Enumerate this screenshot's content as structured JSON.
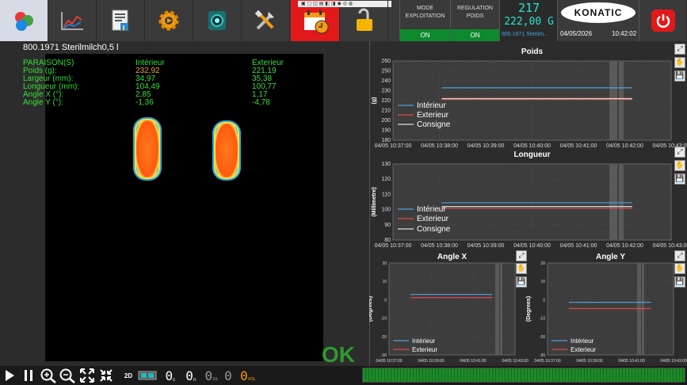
{
  "toolbar": {
    "buttons": [
      {
        "name": "home",
        "icon": "colored-dots-logo-icon"
      },
      {
        "name": "trends",
        "icon": "line-chart-icon"
      },
      {
        "name": "report",
        "icon": "report-document-icon"
      },
      {
        "name": "settings",
        "icon": "gear-icon"
      },
      {
        "name": "camera",
        "icon": "camera-icon"
      },
      {
        "name": "tools",
        "icon": "tools-icon"
      },
      {
        "name": "calendar-alarm",
        "icon": "calendar-alarm-icon"
      },
      {
        "name": "lock",
        "icon": "padlock-open-icon"
      }
    ],
    "mode_exploitation": {
      "label": "MODE\nEXPLOITATION",
      "state": "ON"
    },
    "regulation_poids": {
      "label": "REGULATION\nPOIDS",
      "state": "ON"
    },
    "counter": "217",
    "weight_display": "222,00 G",
    "product_ref": "800.1971 Sterilm...",
    "brand": "KONATIC",
    "date": "04/05/2026",
    "time": "10:42:02",
    "colors": {
      "active_bg": "#d7dbe6",
      "alarm_red": "#e2191b",
      "on_green": "#0e8a2e",
      "segment_cyan": "#2de3d0"
    }
  },
  "left": {
    "product_title": "800.1971 Sterilmilch0,5 l",
    "header_label": "PARAISON(S)",
    "col_interior": "Intérieur",
    "col_exterior": "Exterieur",
    "rows": [
      {
        "label": "Poids (g):",
        "interior": "232,92",
        "exterior": "221,19"
      },
      {
        "label": "Largeur (mm):",
        "interior": "34,97",
        "exterior": "35,38"
      },
      {
        "label": "Longueur (mm):",
        "interior": "104,49",
        "exterior": "100,77"
      },
      {
        "label": "Angle X (°):",
        "interior": "2,85",
        "exterior": "1,17"
      },
      {
        "label": "Angle Y (°):",
        "interior": "-1,36",
        "exterior": "-4,78"
      }
    ],
    "status": "OK"
  },
  "chart_data": [
    {
      "type": "line",
      "title": "Poids",
      "ylabel": "(g)",
      "ylim": [
        180,
        260
      ],
      "yticks": [
        "260",
        "250",
        "240",
        "230",
        "220",
        "210",
        "200",
        "190",
        "180"
      ],
      "xticks": [
        "04/05 10:37:00",
        "04/05 10:38:00",
        "04/05 10:39:00",
        "04/05 10:40:00",
        "04/05 10:41:00",
        "04/05 10:42:00",
        "04/05 10:43:00"
      ],
      "series": [
        {
          "name": "Intérieur",
          "color": "#4aa3e0",
          "values": [
            232.9,
            232.9
          ]
        },
        {
          "name": "Exterieur",
          "color": "#e04a4a",
          "values": [
            221.2,
            221.2
          ]
        },
        {
          "name": "Consigne",
          "color": "#dddddd",
          "values": [
            222.0,
            222.0
          ]
        }
      ],
      "x_range": [
        "10:38:00",
        "10:42:00"
      ],
      "legend": "bottom-left"
    },
    {
      "type": "line",
      "title": "Longueur",
      "ylabel": "(Millimetre)",
      "ylim": [
        80,
        130
      ],
      "yticks": [
        "130",
        "120",
        "110",
        "100",
        "90",
        "80"
      ],
      "xticks": [
        "04/05 10:37:00",
        "04/05 10:38:00",
        "04/05 10:39:00",
        "04/05 10:40:00",
        "04/05 10:41:00",
        "04/05 10:42:00",
        "04/05 10:43:00"
      ],
      "series": [
        {
          "name": "Intérieur",
          "color": "#4aa3e0",
          "values": [
            104.5,
            104.5
          ]
        },
        {
          "name": "Exterieur",
          "color": "#e04a4a",
          "values": [
            100.8,
            100.8
          ]
        },
        {
          "name": "Consigne",
          "color": "#dddddd",
          "values": [
            102.0,
            102.0
          ]
        }
      ],
      "legend": "bottom-left"
    },
    {
      "type": "line",
      "title": "Angle X",
      "ylabel": "(Degrees)",
      "ylim": [
        -30,
        20
      ],
      "yticks": [
        "20",
        "10",
        "0",
        "-10",
        "-20",
        "-30"
      ],
      "xticks": [
        "04/05 10:37:00",
        "04/05 10:39:00",
        "04/05 10:41:00",
        "04/05 10:43:00"
      ],
      "series": [
        {
          "name": "Intérieur",
          "color": "#4aa3e0",
          "values": [
            2.9,
            2.9
          ]
        },
        {
          "name": "Exterieur",
          "color": "#e04a4a",
          "values": [
            1.2,
            1.2
          ]
        }
      ],
      "legend": "bottom-left"
    },
    {
      "type": "line",
      "title": "Angle Y",
      "ylabel": "(Degrees)",
      "ylim": [
        -30,
        20
      ],
      "yticks": [
        "20",
        "10",
        "0",
        "-10",
        "-20",
        "-30"
      ],
      "xticks": [
        "04/05 10:37:00",
        "04/05 10:39:00",
        "04/05 10:41:00",
        "04/05 10:43:00"
      ],
      "series": [
        {
          "name": "Intérieur",
          "color": "#4aa3e0",
          "values": [
            -1.4,
            -1.4
          ]
        },
        {
          "name": "Exterieur",
          "color": "#e04a4a",
          "values": [
            -4.8,
            -4.8
          ]
        }
      ],
      "legend": "bottom-left"
    }
  ],
  "bottom": {
    "icons": [
      "play-icon",
      "pause-icon",
      "zoom-in-icon",
      "zoom-out-icon",
      "fit-expand-icon",
      "fit-shrink-icon"
    ],
    "mode_2d": "2D",
    "counters": [
      {
        "value": "0",
        "suffix": "c"
      },
      {
        "value": "0",
        "suffix": "n"
      },
      {
        "value": "0",
        "suffix": "SIL"
      },
      {
        "value": "0",
        "suffix": ""
      },
      {
        "value": "0",
        "suffix": "VOL"
      }
    ],
    "progress": 1.0,
    "progress_color": "#1e8a2a"
  }
}
